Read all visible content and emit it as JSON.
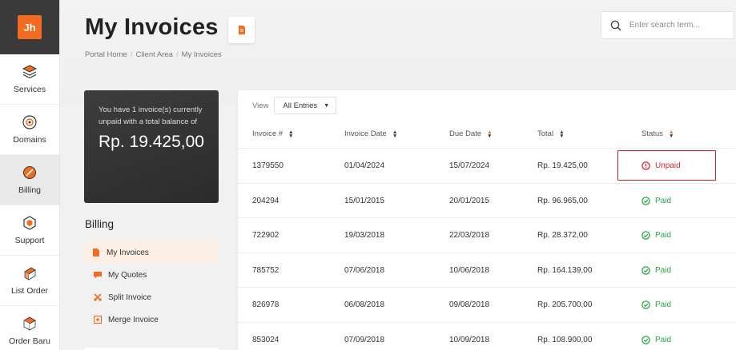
{
  "app": {
    "logo_text": "Jh"
  },
  "rail": {
    "items": [
      {
        "label": "Services",
        "icon": "layers-icon"
      },
      {
        "label": "Domains",
        "icon": "globe-icon"
      },
      {
        "label": "Billing",
        "icon": "billing-icon",
        "active": true
      },
      {
        "label": "Support",
        "icon": "support-icon"
      },
      {
        "label": "List Order",
        "icon": "list-order-icon"
      },
      {
        "label": "Order Baru",
        "icon": "new-order-icon"
      }
    ]
  },
  "header": {
    "title": "My Invoices",
    "breadcrumb": [
      "Portal Home",
      "Client Area",
      "My Invoices"
    ]
  },
  "search": {
    "placeholder": "Enter search term..."
  },
  "balance": {
    "message": "You have 1 invoice(s) currently unpaid with a total balance of",
    "amount": "Rp. 19.425,00"
  },
  "billing_menu": {
    "title": "Billing",
    "items": [
      {
        "label": "My Invoices",
        "icon": "invoice-icon",
        "active": true
      },
      {
        "label": "My Quotes",
        "icon": "quote-icon"
      },
      {
        "label": "Split Invoice",
        "icon": "split-icon"
      },
      {
        "label": "Merge Invoice",
        "icon": "merge-icon"
      }
    ]
  },
  "table": {
    "view_label": "View",
    "view_value": "All Entries",
    "columns": [
      "Invoice #",
      "Invoice Date",
      "Due Date",
      "Total",
      "Status"
    ],
    "rows": [
      {
        "invoice": "1379550",
        "invoice_date": "01/04/2024",
        "due_date": "15/07/2024",
        "total": "Rp. 19.425,00",
        "status": "Unpaid"
      },
      {
        "invoice": "204294",
        "invoice_date": "15/01/2015",
        "due_date": "20/01/2015",
        "total": "Rp. 96.965,00",
        "status": "Paid"
      },
      {
        "invoice": "722902",
        "invoice_date": "19/03/2018",
        "due_date": "22/03/2018",
        "total": "Rp. 28.372,00",
        "status": "Paid"
      },
      {
        "invoice": "785752",
        "invoice_date": "07/06/2018",
        "due_date": "10/06/2018",
        "total": "Rp. 164.139,00",
        "status": "Paid"
      },
      {
        "invoice": "826978",
        "invoice_date": "06/08/2018",
        "due_date": "09/08/2018",
        "total": "Rp. 205.700,00",
        "status": "Paid"
      },
      {
        "invoice": "853024",
        "invoice_date": "07/09/2018",
        "due_date": "10/09/2018",
        "total": "Rp. 108.900,00",
        "status": "Paid"
      }
    ]
  },
  "colors": {
    "accent": "#f26b21",
    "paid": "#28a745",
    "unpaid": "#d9282f"
  }
}
